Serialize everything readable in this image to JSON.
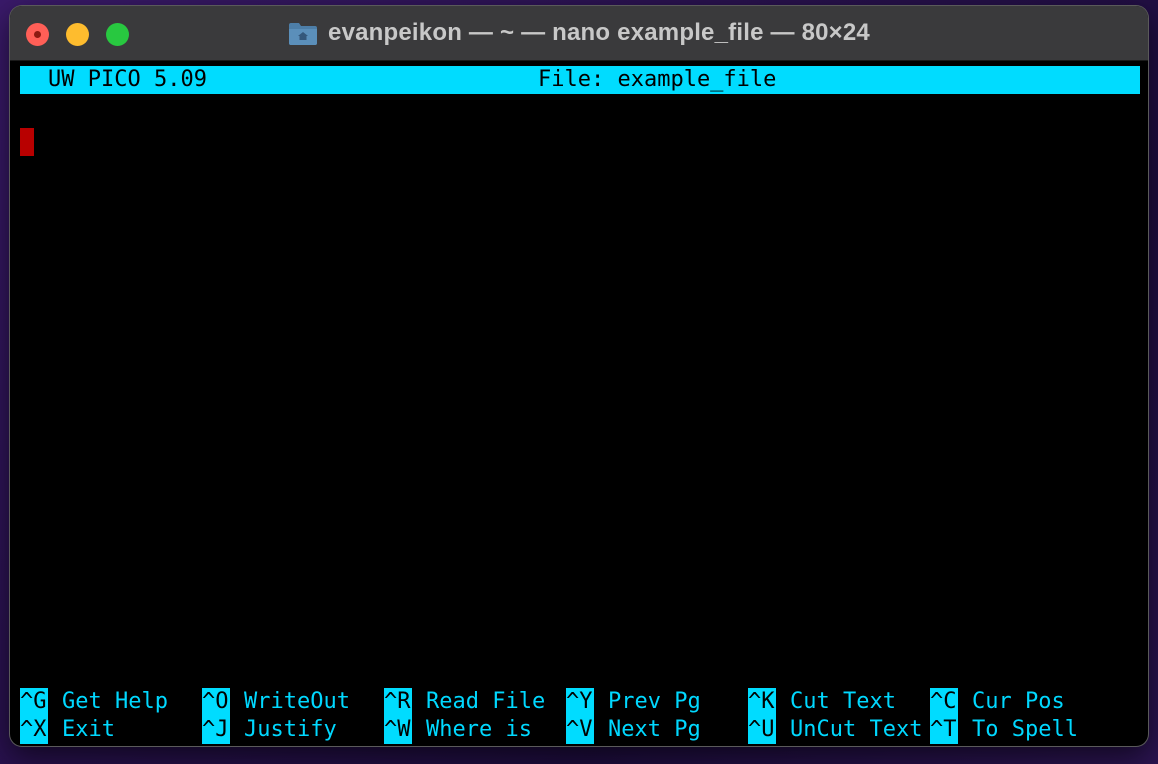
{
  "window": {
    "title": "evanpeikon — ~ — nano example_file — 80×24",
    "folder_icon": "folder-icon"
  },
  "colors": {
    "terminal_bg": "#000000",
    "accent_cyan": "#00dcff",
    "cursor_red": "#b80000",
    "titlebar_bg": "#3a3a3c"
  },
  "editor": {
    "version": "UW PICO 5.09",
    "file_label": "File: example_file",
    "content": ""
  },
  "shortcuts": {
    "row1": [
      {
        "key": "^G",
        "label": "Get Help"
      },
      {
        "key": "^O",
        "label": "WriteOut"
      },
      {
        "key": "^R",
        "label": "Read File"
      },
      {
        "key": "^Y",
        "label": "Prev Pg"
      },
      {
        "key": "^K",
        "label": "Cut Text"
      },
      {
        "key": "^C",
        "label": "Cur Pos"
      }
    ],
    "row2": [
      {
        "key": "^X",
        "label": "Exit"
      },
      {
        "key": "^J",
        "label": "Justify"
      },
      {
        "key": "^W",
        "label": "Where is"
      },
      {
        "key": "^V",
        "label": "Next Pg"
      },
      {
        "key": "^U",
        "label": "UnCut Text"
      },
      {
        "key": "^T",
        "label": "To Spell"
      }
    ]
  }
}
